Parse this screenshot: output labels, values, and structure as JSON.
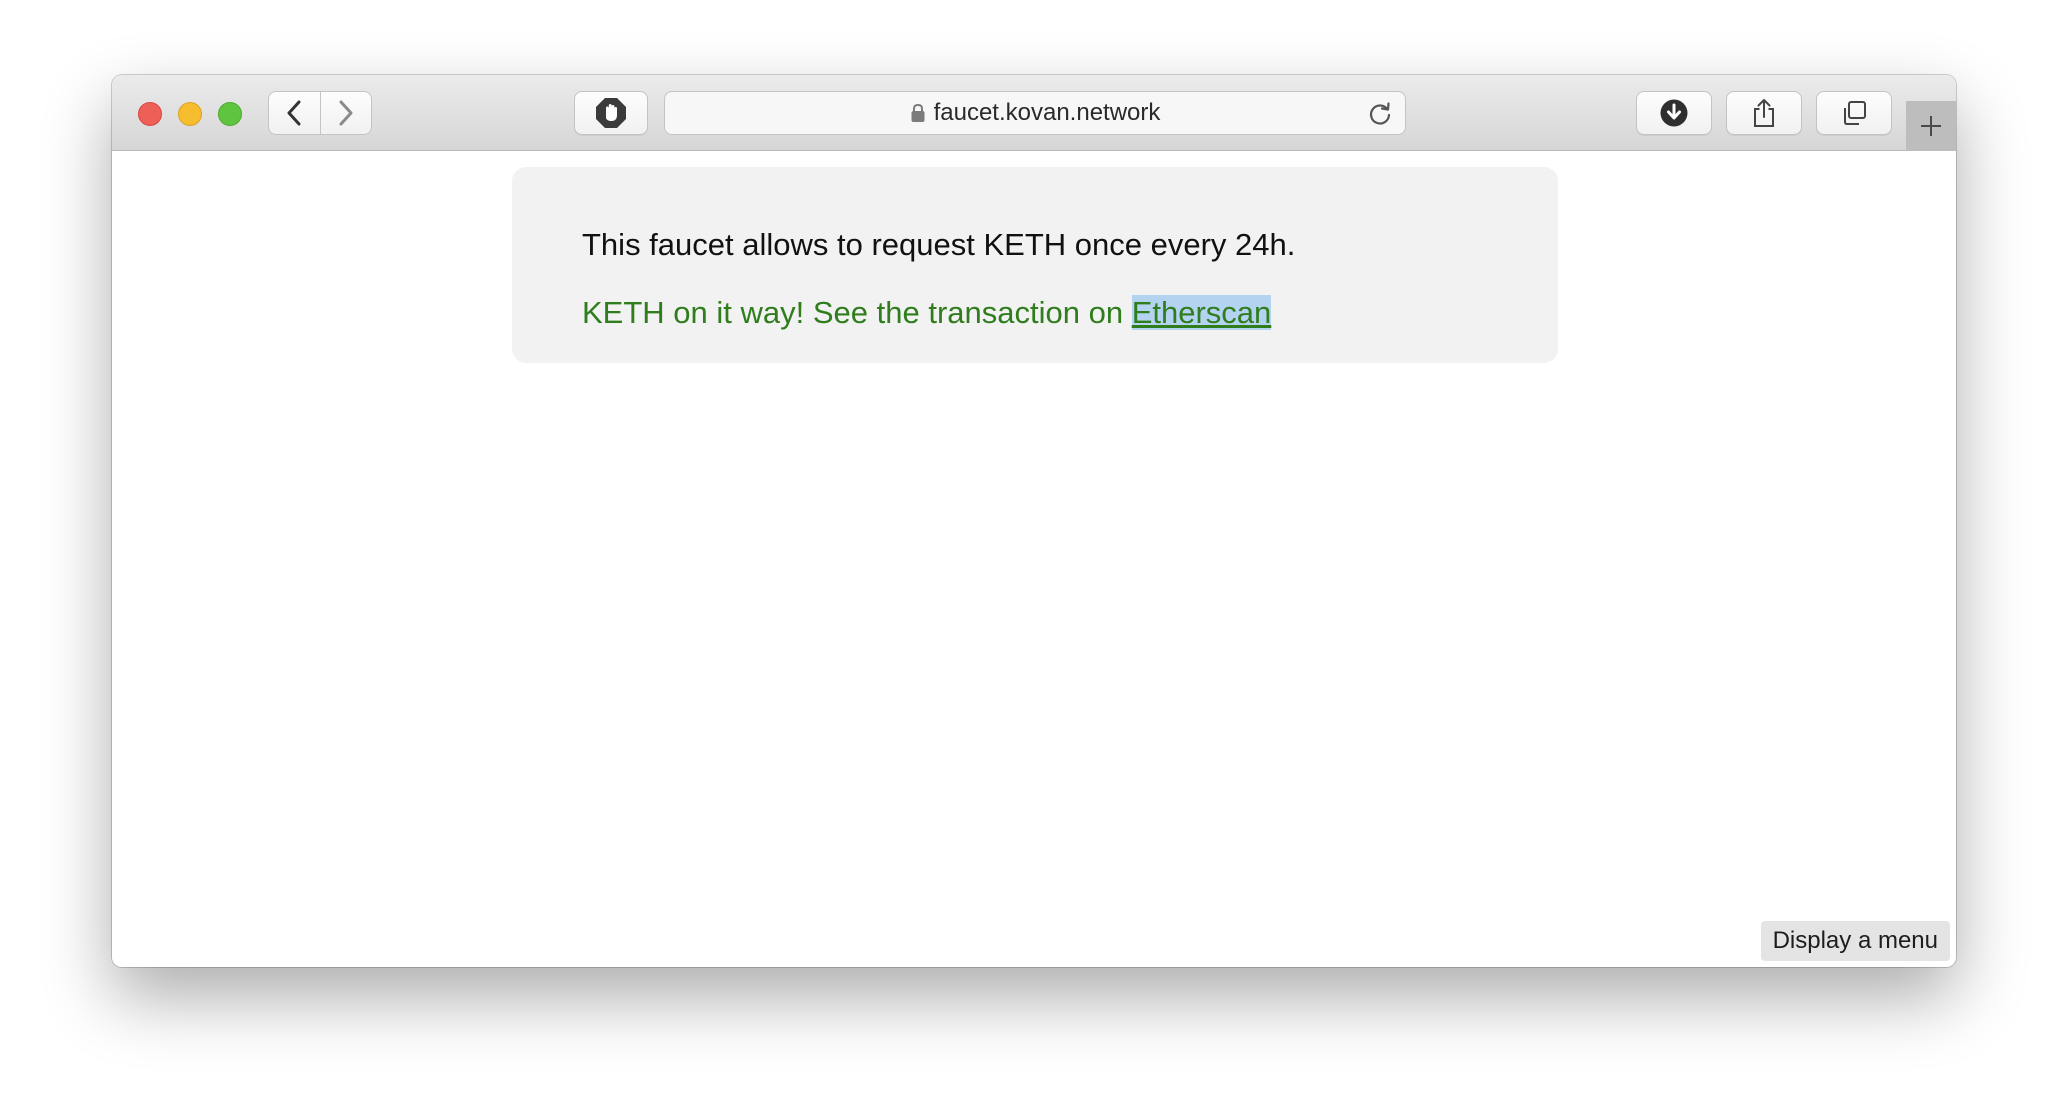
{
  "browser": {
    "address_url": "faucet.kovan.network",
    "icons": {
      "back": "chevron-left-icon",
      "forward": "chevron-right-icon",
      "privacy": "hand-stop-icon",
      "lock": "lock-icon",
      "reload": "reload-icon",
      "download": "download-icon",
      "share": "share-icon",
      "tabs": "tab-overview-icon",
      "new_tab": "plus-icon"
    }
  },
  "page": {
    "intro_text": "This faucet allows to request KETH once every 24h.",
    "success_text": "KETH on it way! See the transaction on ",
    "success_link": "Etherscan",
    "success_color": "#2f7d1d"
  },
  "overlay": {
    "menu_label": "Display a menu"
  }
}
